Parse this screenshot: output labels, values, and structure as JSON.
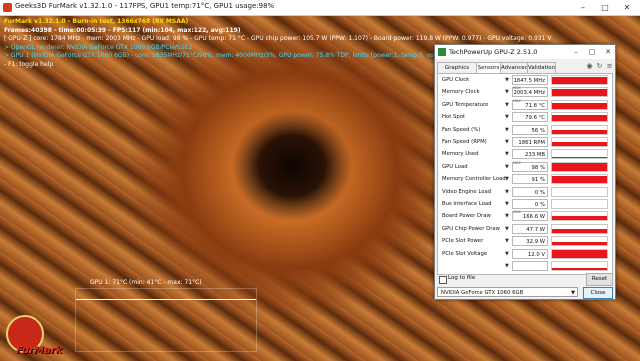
{
  "furmark": {
    "title": "Geeks3D FurMark v1.32.1.0 - 117FPS, GPU1 temp:71°C, GPU1 usage:98%",
    "minimize_icon": "minimize-icon",
    "maximize_icon": "maximize-icon",
    "close_icon": "close-icon",
    "hud": {
      "line1": "FurMark v1.32.1.0 - Burn-in test, 1366x768 (8X MSAA)",
      "line2": "Frames:40398 - time:00:05:39 - FPS:117 (min:104, max:122, avg:119)",
      "line3": "[ GPU-Z ] core: 1784 MHz - mem: 2003 MHz - GPU load: 98 % - GPU temp: 71 °C - GPU chip power: 105.7 W (PPW: 1.107) - Board power: 119.8 W (PPW: 0.977) - GPU voltage: 0.931 V",
      "line4": "> OpenGL renderer: NVIDIA GeForce GTX 1060 6GB/PCIe/SSE2",
      "line5": "> GPU 1 (NVIDIA GeForce GTX 1060 6GB) - core: 1835MHz/71°C/98%, mem: 4006MHz/3%, GPU power: 75.8% TDP, limits:[power:1, temp:0, volt:0, OV:0]",
      "line6": "- F1: toggle help"
    },
    "graph_label": "GPU 1: 71°C (min: 41°C - max: 71°C)",
    "logo_text": "FurMark"
  },
  "gpuz": {
    "title": "TechPowerUp GPU-Z 2.51.0",
    "tabs": [
      "Graphics Card",
      "Sensors",
      "Advanced",
      "Validation"
    ],
    "active_tab": "Sensors",
    "sensors": [
      {
        "label": "GPU Clock",
        "value": "1847.5 MHz",
        "fill": 0.9,
        "max": false
      },
      {
        "label": "Memory Clock",
        "value": "2003.4 MHz",
        "fill": 0.92,
        "max": true
      },
      {
        "label": "GPU Temperature",
        "value": "71.8 °C",
        "fill": 0.75,
        "max": true
      },
      {
        "label": "Hot Spot",
        "value": "79.6 °C",
        "fill": 0.8,
        "max": false
      },
      {
        "label": "Fan Speed (%)",
        "value": "56 %",
        "fill": 0.45,
        "max": false
      },
      {
        "label": "Fan Speed (RPM)",
        "value": "1861 RPM",
        "fill": 0.55,
        "max": false
      },
      {
        "label": "Memory Used",
        "value": "233 MB",
        "fill": 0.22,
        "max": false
      },
      {
        "label": "GPU Load",
        "value": "98 %",
        "fill": 0.97,
        "max": true
      },
      {
        "label": "Memory Controller Load",
        "value": "91 %",
        "fill": 0.9,
        "max": false
      },
      {
        "label": "Video Engine Load",
        "value": "0 %",
        "fill": 0.0,
        "max": false
      },
      {
        "label": "Bus Interface Load",
        "value": "0 %",
        "fill": 0.03,
        "max": false
      },
      {
        "label": "Board Power Draw",
        "value": "166.6 W",
        "fill": 0.6,
        "max": true
      },
      {
        "label": "GPU Chip Power Draw",
        "value": "47.7 W",
        "fill": 0.5,
        "max": false
      },
      {
        "label": "PCIe Slot Power",
        "value": "32.9 W",
        "fill": 0.4,
        "max": false
      },
      {
        "label": "PCIe Slot Voltage",
        "value": "12.0 V",
        "fill": 0.95,
        "max": false
      },
      {
        "label": "",
        "value": "",
        "fill": 0.3,
        "max": false
      }
    ],
    "max_badge": "MAX",
    "log_label": "Log to file",
    "reset_label": "Reset",
    "gpu_selected": "NVIDIA GeForce GTX 1060 6GB",
    "close_label": "Close"
  }
}
